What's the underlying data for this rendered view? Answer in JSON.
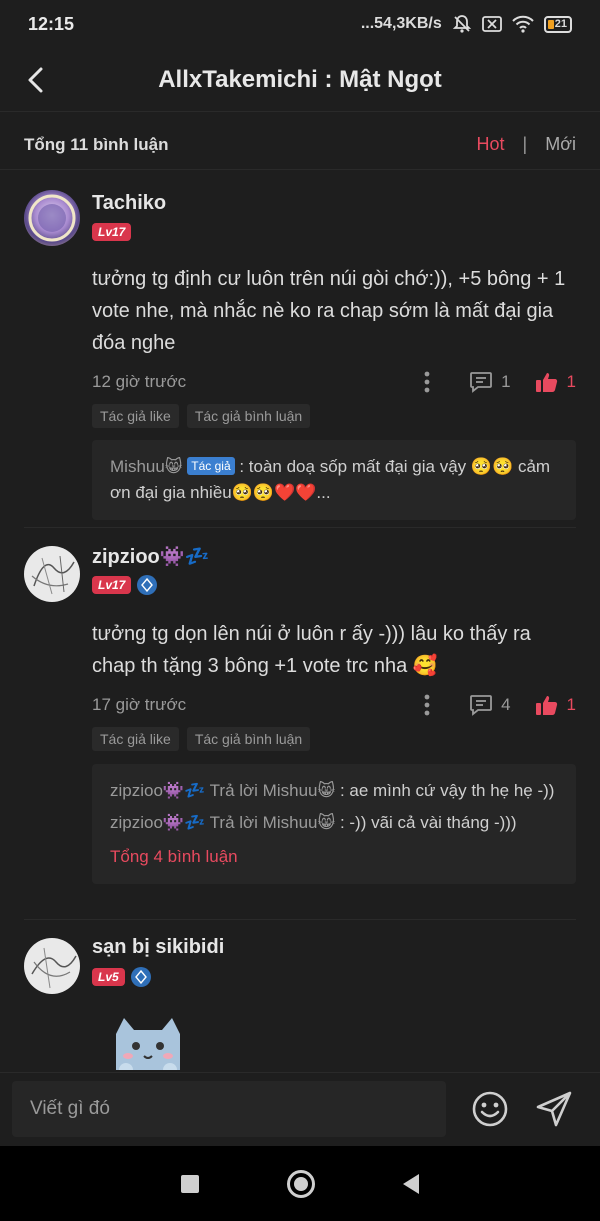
{
  "status": {
    "time": "12:15",
    "network": "...54,3KB/s",
    "battery": "21"
  },
  "header": {
    "title": "AllxTakemichi : Mật Ngọt"
  },
  "summary": {
    "total": "Tổng 11 bình luận",
    "sort_hot": "Hot",
    "sort_sep": "|",
    "sort_new": "Mới"
  },
  "comments": [
    {
      "name": "Tachiko",
      "level": "Lv17",
      "text": "tưởng tg định cư luôn trên núi gòi chớ:)), +5 bông + 1 vote nhe, mà nhắc nè ko ra chap sớm là mất đại gia đóa nghe",
      "time": "12 giờ trước",
      "replies": "1",
      "likes": "1",
      "tags": [
        "Tác giả like",
        "Tác giả bình luận"
      ],
      "reply_user": "Mishuu😸",
      "author_badge": "Tác giả",
      "reply_text": " : toàn doạ sốp mất đại gia vậy 🥺🥺 cảm ơn đại gia nhiều🥺🥺❤️❤️..."
    },
    {
      "name": "zipzioo👾💤",
      "level": "Lv17",
      "text": "tưởng tg dọn lên núi ở luôn r ấy -))) lâu ko thấy ra chap th tặng 3 bông +1 vote trc nha 🥰",
      "time": "17 giờ trước",
      "replies": "4",
      "likes": "1",
      "tags": [
        "Tác giả like",
        "Tác giả bình luận"
      ],
      "reply1_user": "zipzioo👾💤 Trả lời Mishuu😸",
      "reply1_text": " : ae mình cứ vậy th hẹ hẹ -))",
      "reply2_user": "zipzioo👾💤 Trả lời Mishuu😸",
      "reply2_text": " : -)) vãi cả vài tháng -)))",
      "total_replies": "Tổng 4 bình luận"
    },
    {
      "name": "sạn bị sikibidi",
      "level": "Lv5"
    }
  ],
  "input": {
    "placeholder": "Viết gì đó"
  },
  "colors": {
    "accent": "#e84a5f",
    "background": "#1e1e1e",
    "author_badge": "#3b7fd0"
  }
}
